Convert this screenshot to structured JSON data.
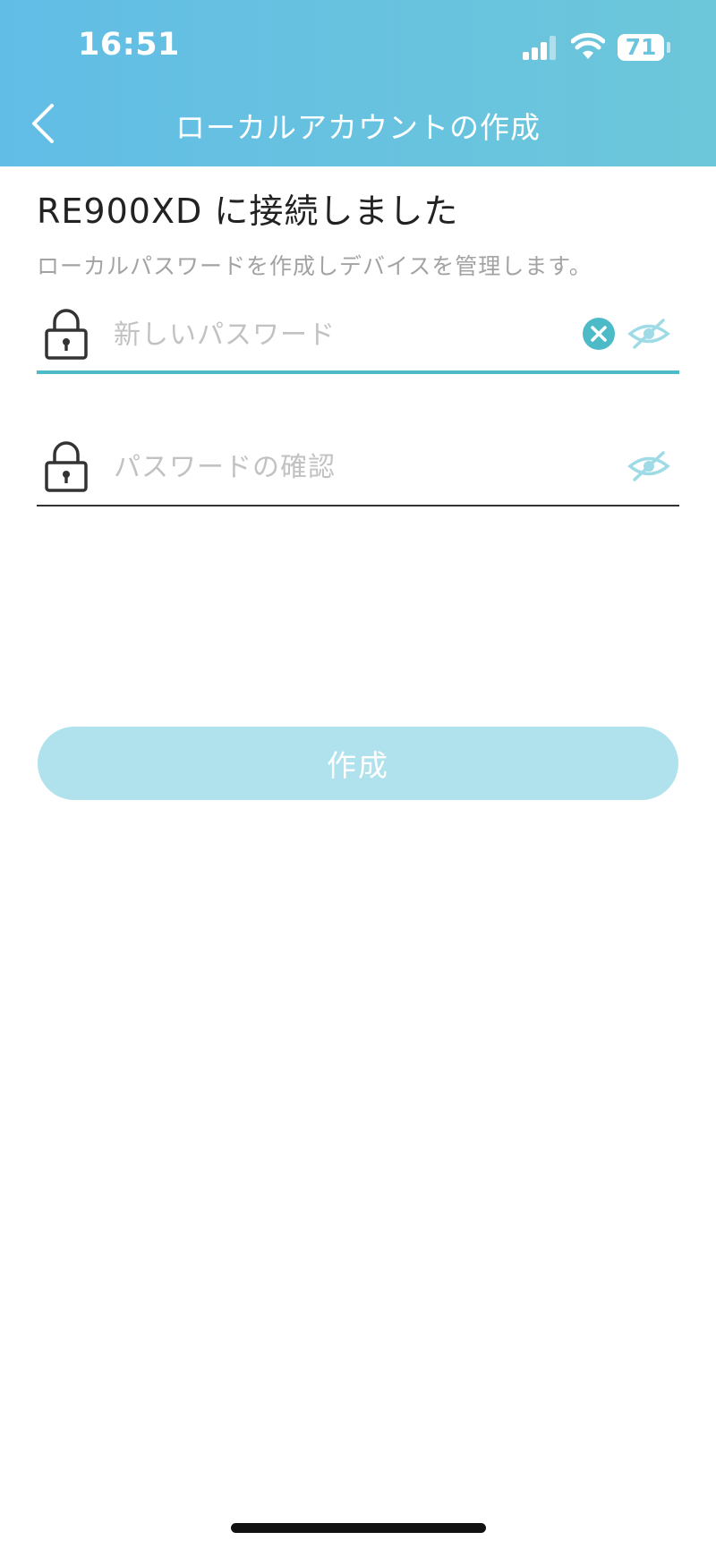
{
  "status_bar": {
    "time": "16:51",
    "battery": "71"
  },
  "nav": {
    "title": "ローカルアカウントの作成"
  },
  "content": {
    "headline": "RE900XD に接続しました",
    "subtitle": "ローカルパスワードを作成しデバイスを管理します。"
  },
  "fields": {
    "new_password": {
      "placeholder": "新しいパスワード",
      "value": ""
    },
    "confirm_password": {
      "placeholder": "パスワードの確認",
      "value": ""
    }
  },
  "actions": {
    "create_label": "作成"
  },
  "colors": {
    "header_start": "#62bde6",
    "header_end": "#6cc7da",
    "accent": "#4dbac8",
    "button_disabled": "#afe2ec",
    "eye_icon": "#9edbe6"
  }
}
